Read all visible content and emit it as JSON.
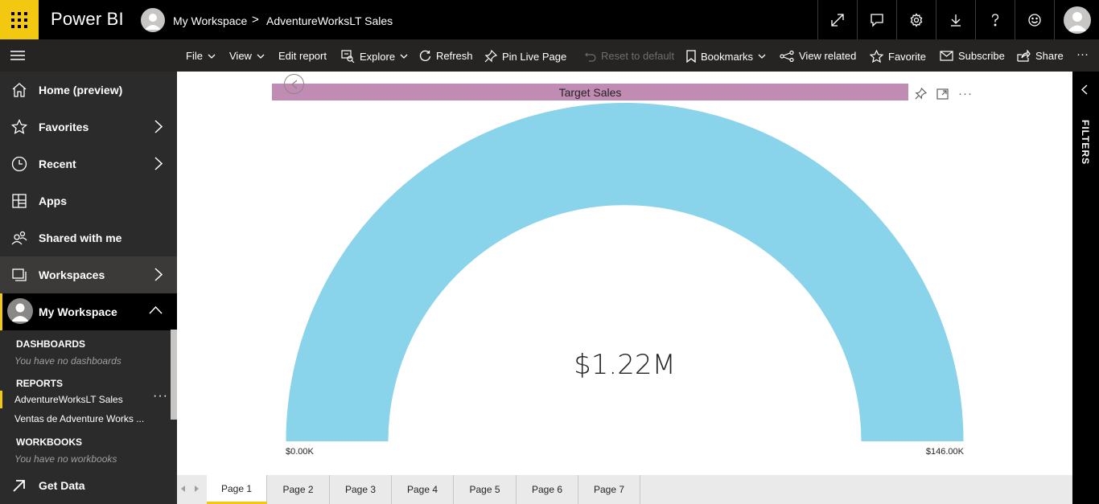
{
  "app": {
    "brand": "Power BI",
    "accent_color": "#f2c811"
  },
  "breadcrumb": {
    "workspace": "My Workspace",
    "separator": ">",
    "report": "AdventureWorksLT Sales"
  },
  "header_icons": [
    "expand-icon",
    "comment-icon",
    "settings-icon",
    "download-icon",
    "help-icon",
    "feedback-smiley-icon",
    "account-avatar"
  ],
  "actionbar": {
    "file": "File",
    "view": "View",
    "edit_report": "Edit report",
    "explore": "Explore",
    "refresh": "Refresh",
    "pin_live_page": "Pin Live Page",
    "reset_to_default": "Reset to default",
    "bookmarks": "Bookmarks",
    "view_related": "View related",
    "favorite": "Favorite",
    "subscribe": "Subscribe",
    "share": "Share",
    "more": "···"
  },
  "nav": {
    "home": "Home (preview)",
    "favorites": "Favorites",
    "recent": "Recent",
    "apps": "Apps",
    "shared": "Shared with me",
    "workspaces": "Workspaces",
    "my_workspace": "My Workspace",
    "dashboards_header": "DASHBOARDS",
    "dashboards_empty": "You have no dashboards",
    "reports_header": "REPORTS",
    "reports": [
      "AdventureWorksLT Sales",
      "Ventas de Adventure Works ..."
    ],
    "report_more": "···",
    "workbooks_header": "WORKBOOKS",
    "workbooks_empty": "You have no workbooks",
    "get_data": "Get Data"
  },
  "visual": {
    "title": "Target Sales",
    "title_bg": "#c18cb4"
  },
  "chart_data": {
    "type": "gauge",
    "title": "Target Sales",
    "value": 1220000,
    "value_label": "$1.22M",
    "min": 0,
    "max": 146000,
    "min_label": "$0.00K",
    "max_label": "$146.00K",
    "fill_fraction": 1.0,
    "color": "#8ad4eb"
  },
  "filters": {
    "label": "FILTERS"
  },
  "pages": [
    "Page 1",
    "Page 2",
    "Page 3",
    "Page 4",
    "Page 5",
    "Page 6",
    "Page 7"
  ],
  "active_page": "Page 1"
}
